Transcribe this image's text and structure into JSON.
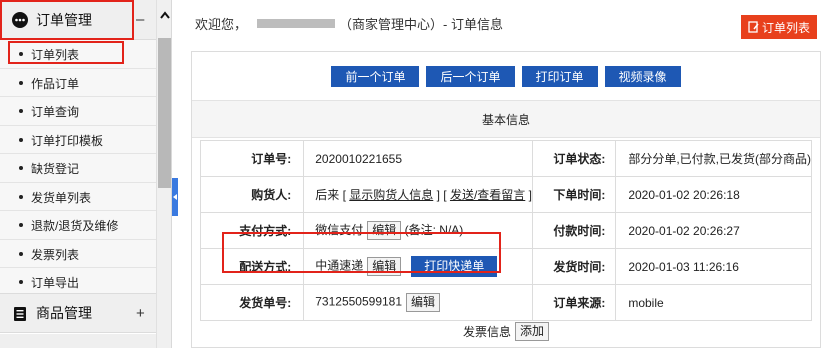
{
  "sidebar": {
    "section1": {
      "label": "订单管理",
      "toggle": "–",
      "icon": "ellipsis-circle-icon"
    },
    "items": [
      {
        "label": "订单列表"
      },
      {
        "label": "作品订单"
      },
      {
        "label": "订单查询"
      },
      {
        "label": "订单打印模板"
      },
      {
        "label": "缺货登记"
      },
      {
        "label": "发货单列表"
      },
      {
        "label": "退款/退货及维修"
      },
      {
        "label": "发票列表"
      },
      {
        "label": "订单导出"
      }
    ],
    "section2": {
      "label": "商品管理",
      "toggle": "+",
      "icon": "document-icon"
    }
  },
  "header": {
    "welcome_prefix": "欢迎您，",
    "welcome_suffix": "（商家管理中心）- 订单信息",
    "order_list_button": "订单列表"
  },
  "actions": [
    "前一个订单",
    "后一个订单",
    "打印订单",
    "视频录像"
  ],
  "section_title": "基本信息",
  "info": {
    "order_no_label": "订单号:",
    "order_no": "2020010221655",
    "status_label": "订单状态:",
    "status": "部分分单,已付款,已发货(部分商品)",
    "buyer_label": "购货人:",
    "buyer_prefix": "后来 [ ",
    "buyer_show_info": "显示购货人信息",
    "buyer_mid": " ] [ ",
    "buyer_message": "发送/查看留言",
    "buyer_suffix": " ]",
    "order_time_label": "下单时间:",
    "order_time": "2020-01-02 20:26:18",
    "payment_label": "支付方式:",
    "payment": "微信支付",
    "payment_note": "(备注: N/A)",
    "pay_time_label": "付款时间:",
    "pay_time": "2020-01-02 20:26:27",
    "shipping_label": "配送方式:",
    "shipping": "中通速递",
    "print_express": "打印快递单",
    "ship_time_label": "发货时间:",
    "ship_time": "2020-01-03 11:26:16",
    "invoice_no_label": "发货单号:",
    "invoice_no": "7312550599181",
    "source_label": "订单来源:",
    "source": "mobile",
    "edit": "编辑"
  },
  "invoice": {
    "label": "发票信息",
    "add": "添加"
  },
  "colors": {
    "accent_blue": "#1e58b4",
    "accent_red": "#e8401c",
    "highlight": "#e2231a"
  }
}
